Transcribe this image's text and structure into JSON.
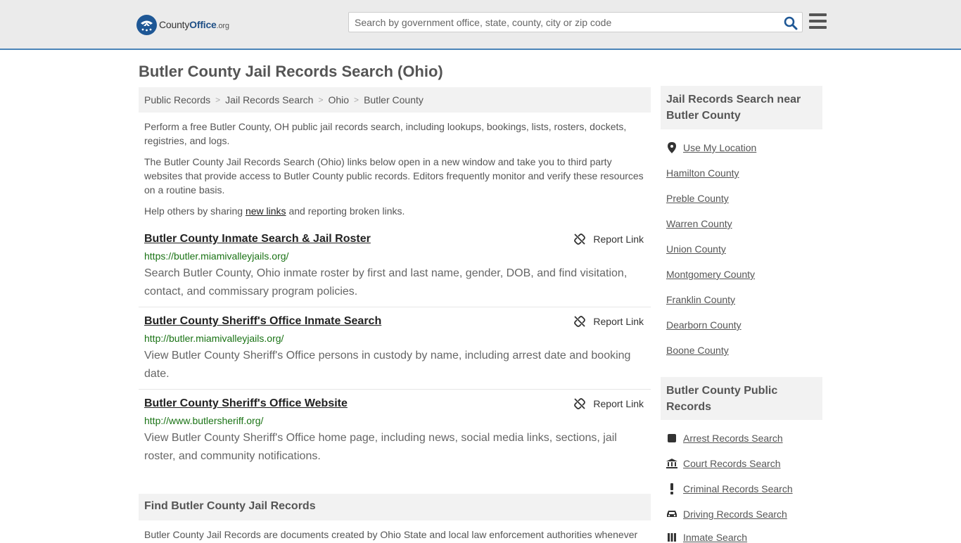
{
  "header": {
    "logo": {
      "part1": "County",
      "part2": "Office",
      "part3": ".org"
    },
    "search_placeholder": "Search by government office, state, county, city or zip code"
  },
  "page_title": "Butler County Jail Records Search (Ohio)",
  "breadcrumb": [
    "Public Records",
    "Jail Records Search",
    "Ohio",
    "Butler County"
  ],
  "intro": {
    "p1": "Perform a free Butler County, OH public jail records search, including lookups, bookings, lists, rosters, dockets, registries, and logs.",
    "p2": "The Butler County Jail Records Search (Ohio) links below open in a new window and take you to third party websites that provide access to Butler County public records. Editors frequently monitor and verify these resources on a routine basis.",
    "p3_before": "Help others by sharing ",
    "p3_link": "new links",
    "p3_after": " and reporting broken links."
  },
  "report_label": "Report Link",
  "results": [
    {
      "title": "Butler County Inmate Search & Jail Roster",
      "url": "https://butler.miamivalleyjails.org/",
      "desc": "Search Butler County, Ohio inmate roster by first and last name, gender, DOB, and find visitation, contact, and commissary program policies."
    },
    {
      "title": "Butler County Sheriff's Office Inmate Search",
      "url": "http://butler.miamivalleyjails.org/",
      "desc": "View Butler County Sheriff's Office persons in custody by name, including arrest date and booking date."
    },
    {
      "title": "Butler County Sheriff's Office Website",
      "url": "http://www.butlersheriff.org/",
      "desc": "View Butler County Sheriff's Office home page, including news, social media links, sections, jail roster, and community notifications."
    }
  ],
  "find_section": {
    "heading": "Find Butler County Jail Records",
    "text": "Butler County Jail Records are documents created by Ohio State and local law enforcement authorities whenever"
  },
  "sidebar": {
    "nearby_heading": "Jail Records Search near Butler County",
    "use_location": "Use My Location",
    "nearby": [
      "Hamilton County",
      "Preble County",
      "Warren County",
      "Union County",
      "Montgomery County",
      "Franklin County",
      "Dearborn County",
      "Boone County"
    ],
    "public_heading": "Butler County Public Records",
    "public_records": [
      {
        "label": "Arrest Records Search",
        "icon": "arrest-icon"
      },
      {
        "label": "Court Records Search",
        "icon": "courthouse-icon"
      },
      {
        "label": "Criminal Records Search",
        "icon": "exclamation-icon"
      },
      {
        "label": "Driving Records Search",
        "icon": "car-icon"
      },
      {
        "label": "Inmate Search",
        "icon": "inmate-icon"
      }
    ]
  },
  "colors": {
    "header_bg": "#ebebeb",
    "header_border": "#4b84b8",
    "link_green": "#1a7315",
    "brand_blue": "#1e5795"
  }
}
